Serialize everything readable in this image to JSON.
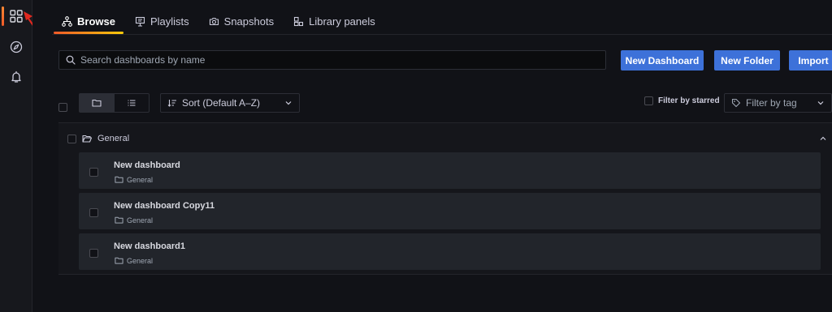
{
  "sidenav": {
    "items": [
      {
        "name": "dashboards",
        "icon": "apps-grid-icon",
        "active": true
      },
      {
        "name": "explore",
        "icon": "compass-icon",
        "active": false
      },
      {
        "name": "alerting",
        "icon": "bell-icon",
        "active": false
      }
    ]
  },
  "tabs": [
    {
      "label": "Browse",
      "icon": "sitemap-icon",
      "active": true
    },
    {
      "label": "Playlists",
      "icon": "presentation-icon",
      "active": false
    },
    {
      "label": "Snapshots",
      "icon": "camera-icon",
      "active": false
    },
    {
      "label": "Library panels",
      "icon": "library-panel-icon",
      "active": false
    }
  ],
  "search": {
    "placeholder": "Search dashboards by name",
    "value": ""
  },
  "actions": {
    "new_dashboard": "New Dashboard",
    "new_folder": "New Folder",
    "import": "Import"
  },
  "filters": {
    "sort_label": "Sort (Default A–Z)",
    "starred_label": "Filter by starred",
    "tag_placeholder": "Filter by tag"
  },
  "folder": {
    "name": "General"
  },
  "dashboards": [
    {
      "title": "New dashboard",
      "folder": "General"
    },
    {
      "title": "New dashboard Copy11",
      "folder": "General"
    },
    {
      "title": "New dashboard1",
      "folder": "General"
    }
  ],
  "colors": {
    "accent": "#3d71d9",
    "annotation_arrow": "#e0281f",
    "active_indicator": "#f05a28",
    "background": "#111217"
  }
}
